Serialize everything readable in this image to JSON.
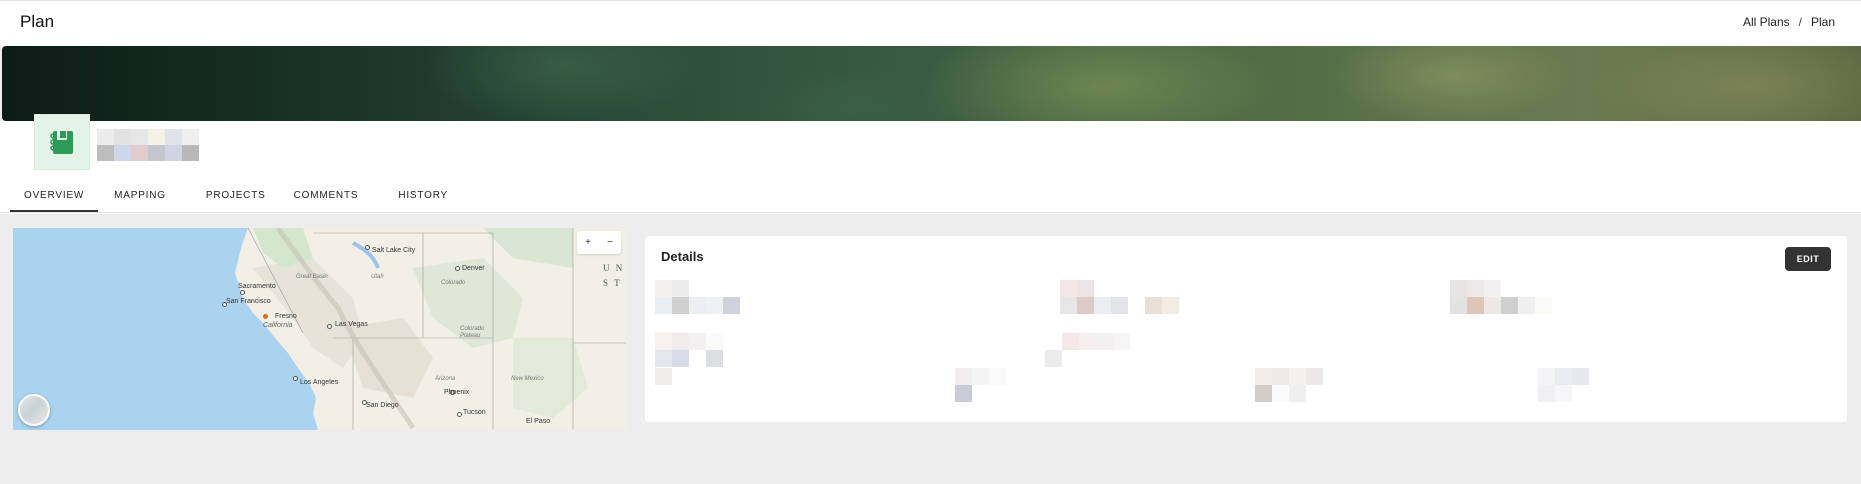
{
  "header": {
    "title": "Plan"
  },
  "breadcrumb": {
    "items": [
      "All Plans",
      "Plan"
    ],
    "separator": "/"
  },
  "tabs": [
    {
      "label": "OVERVIEW",
      "active": true
    },
    {
      "label": "MAPPING",
      "active": false
    },
    {
      "label": "PROJECTS",
      "active": false
    },
    {
      "label": "COMMENTS",
      "active": false
    },
    {
      "label": "HISTORY",
      "active": false
    }
  ],
  "map": {
    "zoom_in": "+",
    "zoom_out": "−",
    "labels": {
      "salt_lake_city": "Salt Lake City",
      "denver": "Denver",
      "sacramento": "Sacramento",
      "great_basin": "Great Basin",
      "utah": "Utah",
      "colorado": "Colorado",
      "san_francisco": "San Francisco",
      "fresno": "Fresno",
      "california": "California",
      "las_vegas": "Las Vegas",
      "colorado_plateau": "Colorado Plateau",
      "los_angeles": "Los Angeles",
      "arizona": "Arizona",
      "new_mexico": "New Mexico",
      "phoenix": "Phoenix",
      "san_diego": "San Diego",
      "tucson": "Tucson",
      "el_paso": "El Paso",
      "un": "U N",
      "st": "S T"
    }
  },
  "details": {
    "title": "Details",
    "edit_label": "EDIT"
  },
  "colors": {
    "accent": "#333333",
    "avatar_bg": "#e3f3e8",
    "avatar_icon": "#2e9a58",
    "map_water": "#aad3f0"
  }
}
